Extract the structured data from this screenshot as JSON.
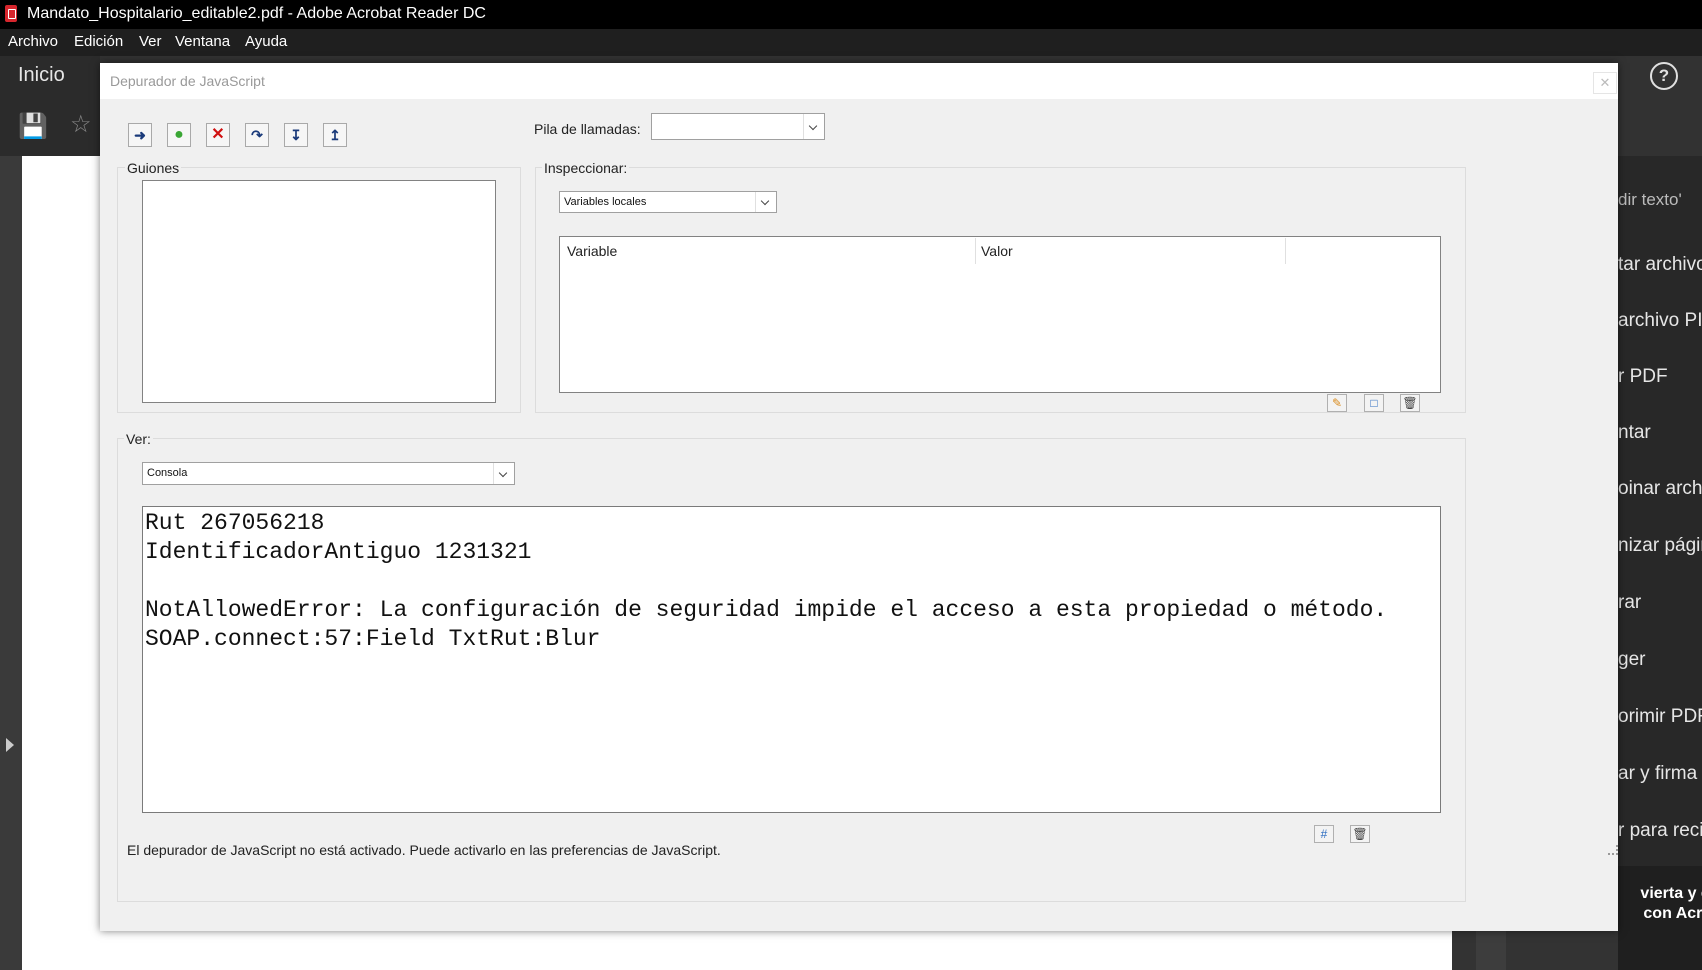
{
  "window": {
    "title": "Mandato_Hospitalario_editable2.pdf - Adobe Acrobat Reader DC"
  },
  "menubar": {
    "items": [
      "Archivo",
      "Edición",
      "Ver",
      "Ventana",
      "Ayuda"
    ]
  },
  "app_toolbar": {
    "home_label": "Inicio"
  },
  "right_panel": {
    "search_placeholder": "dir texto'",
    "items": [
      "tar archivo",
      "archivo PI",
      "r PDF",
      "ntar",
      "oinar archi",
      "nizar págir",
      "rar",
      "ger",
      "orimir PDF",
      "ar y firma",
      "r para reci"
    ],
    "bottom_text_1": "vierta y ed",
    "bottom_text_2": "con Acrol"
  },
  "dialog": {
    "title": "Depurador de JavaScript",
    "call_stack_label": "Pila de llamadas:",
    "call_stack_value": "",
    "scripts_label": "Guiones",
    "inspect_label": "Inspeccionar:",
    "inspect_value": "Variables locales",
    "grid": {
      "col_variable": "Variable",
      "col_value": "Valor"
    },
    "view_label": "Ver:",
    "view_value": "Consola",
    "console_lines": [
      "Rut 267056218",
      "IdentificadorAntiguo 1231321",
      "",
      "NotAllowedError: La configuración de seguridad impide el acceso a esta propiedad o método.",
      "SOAP.connect:57:Field TxtRut:Blur"
    ],
    "status": "El depurador de JavaScript no está activado. Puede activarlo en las preferencias de JavaScript."
  }
}
